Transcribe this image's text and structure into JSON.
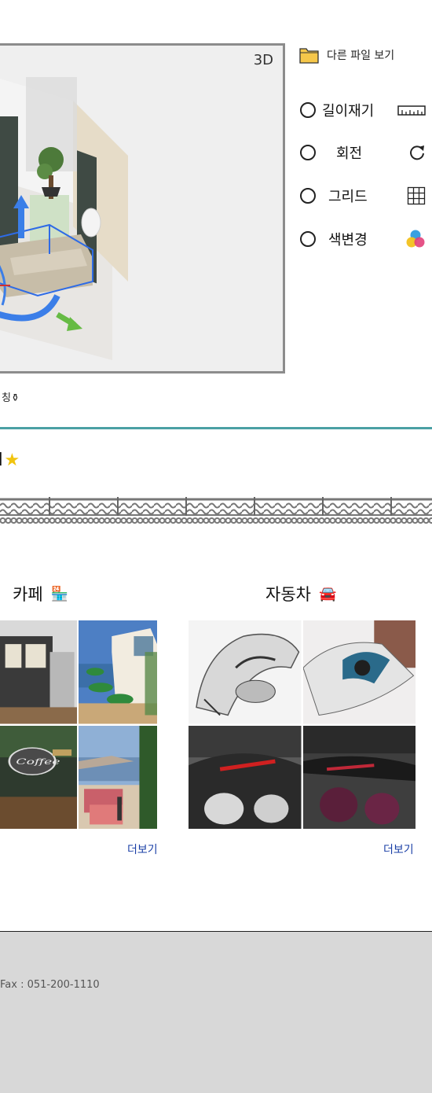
{
  "viewer": {
    "mode_label": "3D"
  },
  "file_link": {
    "label": "다른 파일 보기"
  },
  "tools": [
    {
      "label": "길이재기",
      "icon": "ruler-icon"
    },
    {
      "label": "회전",
      "icon": "rotate-icon"
    },
    {
      "label": "그리드",
      "icon": "grid-icon"
    },
    {
      "label": "색변경",
      "icon": "color-palette-icon"
    }
  ],
  "caption": "칭⚱",
  "section_title": {
    "text": "l",
    "star": "★"
  },
  "categories": [
    {
      "title": "카페",
      "emoji": "🏪",
      "more": "더보기"
    },
    {
      "title": "자동차",
      "emoji": "🚘",
      "more": "더보기"
    }
  ],
  "footer": {
    "fax": "Fax : 051-200-1110"
  },
  "colors": {
    "accent_line": "#4aa0a4",
    "link": "#1a3fa6",
    "footer_bg": "#d8d8d8"
  }
}
